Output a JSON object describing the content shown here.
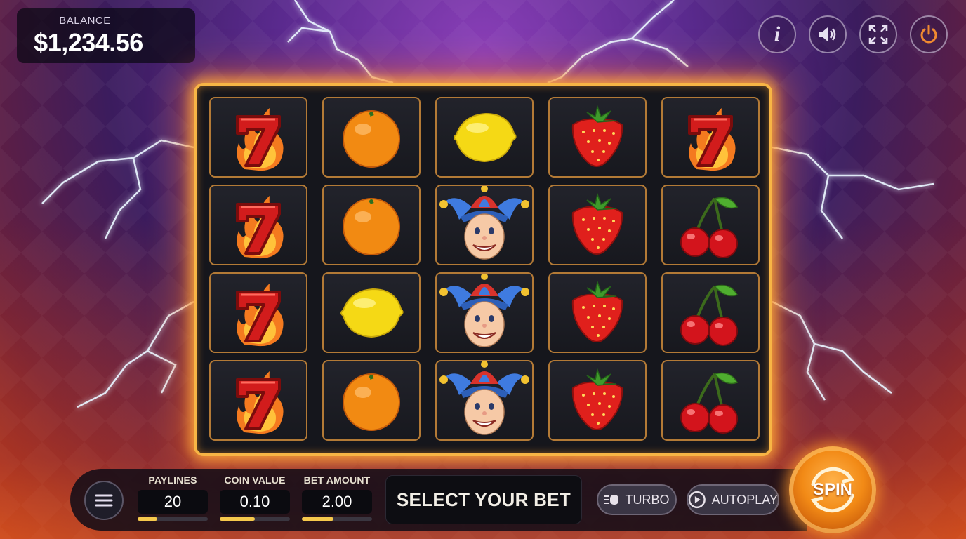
{
  "balance": {
    "label": "BALANCE",
    "value": "$1,234.56"
  },
  "top_controls": [
    {
      "name": "info-button",
      "icon": "info-icon",
      "glyph": "i"
    },
    {
      "name": "sound-button",
      "icon": "speaker-icon"
    },
    {
      "name": "fullscreen-button",
      "icon": "fullscreen-icon"
    },
    {
      "name": "power-button",
      "icon": "power-icon",
      "color": "#f08a30"
    }
  ],
  "reels": [
    [
      "seven",
      "orange",
      "lemon",
      "strawberry",
      "seven"
    ],
    [
      "seven",
      "orange",
      "jester",
      "strawberry",
      "cherries"
    ],
    [
      "seven",
      "lemon",
      "jester",
      "strawberry",
      "cherries"
    ],
    [
      "seven",
      "orange",
      "jester",
      "strawberry",
      "cherries"
    ]
  ],
  "controls": {
    "paylines": {
      "label": "PAYLINES",
      "value": "20",
      "level": 0.28
    },
    "coin_value": {
      "label": "COIN VALUE",
      "value": "0.10",
      "level": 0.5
    },
    "bet_amount": {
      "label": "BET AMOUNT",
      "value": "2.00",
      "level": 0.45
    },
    "select_bet": "SELECT YOUR BET",
    "turbo": "TURBO",
    "autoplay": "AUTOPLAY",
    "spin": "SPIN"
  },
  "colors": {
    "frame": "#f7b545",
    "accent": "#f6c94c",
    "spin": "#f28a16"
  }
}
